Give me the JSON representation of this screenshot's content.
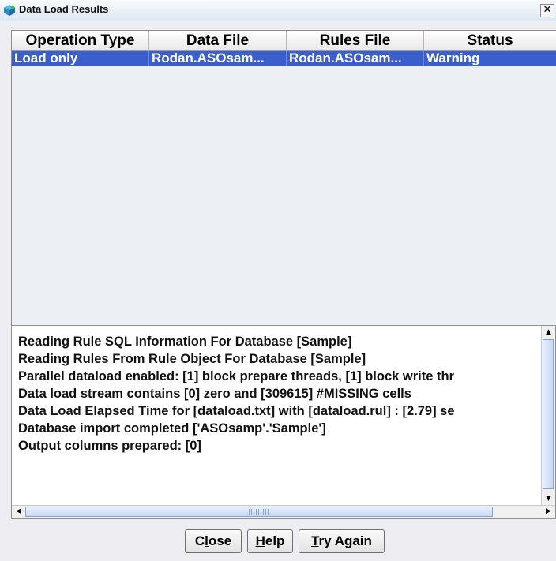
{
  "window": {
    "title": "Data Load Results",
    "close_glyph": "✕",
    "icon": "cube-icon"
  },
  "table": {
    "columns": [
      "Operation Type",
      "Data File",
      "Rules File",
      "Status"
    ],
    "rows": [
      {
        "operation_type": "Load only",
        "data_file": "Rodan.ASOsam...",
        "rules_file": "Rodan.ASOsam...",
        "status": "Warning"
      }
    ]
  },
  "log": {
    "lines": [
      "Reading Rule SQL Information For Database [Sample]",
      "Reading Rules From Rule Object For Database [Sample]",
      "Parallel dataload enabled: [1] block prepare threads, [1] block write thr",
      "Data load stream contains [0] zero and [309615] #MISSING cells",
      "Data Load Elapsed Time for [dataload.txt] with [dataload.rul] : [2.79] se",
      "Database import completed ['ASOsamp'.'Sample']",
      "Output columns prepared: [0]"
    ]
  },
  "buttons": {
    "close": {
      "prefix": "C",
      "mnemonic": "l",
      "suffix": "ose"
    },
    "help": {
      "prefix": "",
      "mnemonic": "H",
      "suffix": "elp"
    },
    "try_again": {
      "prefix": "",
      "mnemonic": "T",
      "suffix": "ry Again"
    }
  },
  "colors": {
    "selection": "#3a5fcd",
    "accent": "#8aa3cc"
  }
}
